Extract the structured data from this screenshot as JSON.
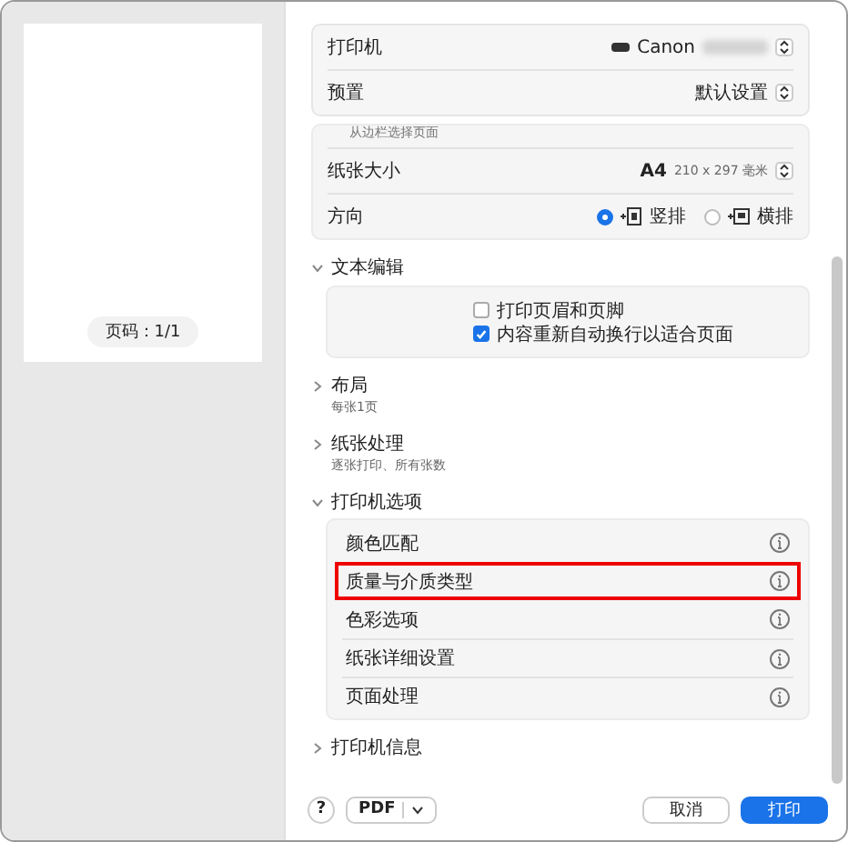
{
  "preview": {
    "page_label": "页码：1/1"
  },
  "header": {
    "rows": [
      {
        "label": "打印机",
        "value": "Canon",
        "kind": "printer"
      },
      {
        "label": "预置",
        "value": "默认设置",
        "kind": "plain"
      }
    ]
  },
  "page_settings": {
    "cut_text": "从边栏选择页面",
    "paper_size": {
      "label": "纸张大小",
      "value": "A4",
      "detail": "210 x 297 毫米"
    },
    "orientation": {
      "label": "方向",
      "options": [
        {
          "label": "竖排",
          "selected": true,
          "kind": "portrait"
        },
        {
          "label": "横排",
          "selected": false,
          "kind": "landscape"
        }
      ]
    }
  },
  "sections": [
    {
      "title": "文本编辑",
      "expanded": true,
      "kind": "checks",
      "checks": [
        {
          "label": "打印页眉和页脚",
          "checked": false
        },
        {
          "label": "内容重新自动换行以适合页面",
          "checked": true
        }
      ]
    },
    {
      "title": "布局",
      "expanded": false,
      "kind": "summary",
      "summary": "每张1页"
    },
    {
      "title": "纸张处理",
      "expanded": false,
      "kind": "summary",
      "summary": "逐张打印、所有张数"
    },
    {
      "title": "打印机选项",
      "expanded": true,
      "kind": "list",
      "items": [
        {
          "label": "颜色匹配",
          "highlighted": false
        },
        {
          "label": "质量与介质类型",
          "highlighted": true
        },
        {
          "label": "色彩选项",
          "highlighted": false
        },
        {
          "label": "纸张详细设置",
          "highlighted": false
        },
        {
          "label": "页面处理",
          "highlighted": false
        }
      ]
    },
    {
      "title": "打印机信息",
      "expanded": false,
      "kind": "summary"
    }
  ],
  "footer": {
    "help": "?",
    "pdf": "PDF",
    "cancel": "取消",
    "print": "打印"
  }
}
